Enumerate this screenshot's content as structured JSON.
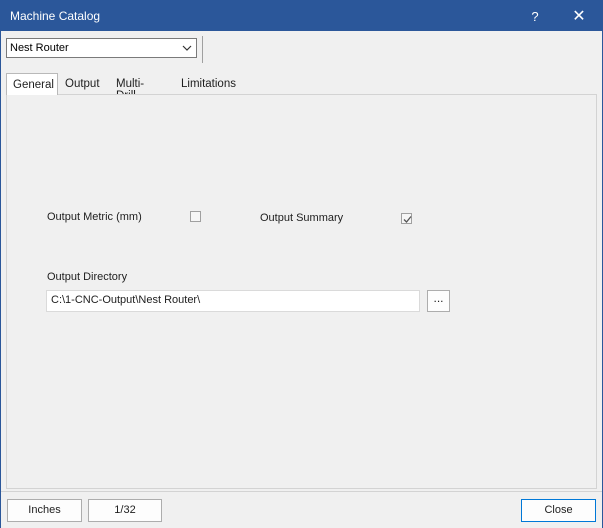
{
  "window": {
    "title": "Machine Catalog",
    "help_glyph": "?",
    "close_glyph": "✕"
  },
  "machine_selector": {
    "selected": "Nest Router"
  },
  "tabs": [
    {
      "label": "General",
      "active": true
    },
    {
      "label": "Output",
      "active": false
    },
    {
      "label": "Multi-Drill",
      "active": false
    },
    {
      "label": "Limitations",
      "active": false
    }
  ],
  "general": {
    "output_metric_label": "Output Metric (mm)",
    "output_metric_checked": false,
    "output_summary_label": "Output Summary",
    "output_summary_checked": true,
    "output_directory_label": "Output Directory",
    "output_directory_value": "C:\\1-CNC-Output\\Nest Router\\",
    "browse_label": "..."
  },
  "footer": {
    "units_label": "Inches",
    "fraction_label": "1/32",
    "close_label": "Close"
  },
  "colors": {
    "titlebar": "#2b579a",
    "background": "#f0f0f0",
    "focus_border": "#0078d7"
  }
}
